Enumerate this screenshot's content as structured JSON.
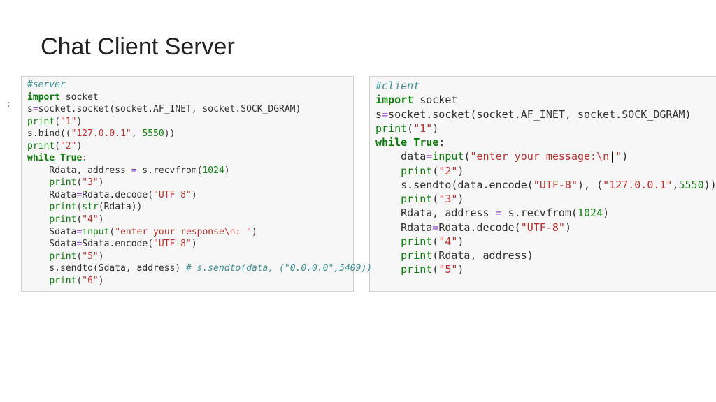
{
  "title": "Chat Client Server",
  "in_prompt": ":",
  "server": {
    "l1": "#server",
    "l2a": "import",
    "l2b": " socket",
    "l3a": "s",
    "l3b": "=",
    "l3c": "socket.socket(socket.AF_INET, socket.SOCK_DGRAM)",
    "l4a": "print",
    "l4b": "(",
    "l4c": "\"1\"",
    "l4d": ")",
    "l5a": "s.bind((",
    "l5b": "\"127.0.0.1\"",
    "l5c": ", ",
    "l5d": "5550",
    "l5e": "))",
    "l6a": "print",
    "l6b": "(",
    "l6c": "\"2\"",
    "l6d": ")",
    "l7a": "while",
    "l7b": " ",
    "l7c": "True",
    "l7d": ":",
    "l8a": "    Rdata, address ",
    "l8b": "=",
    "l8c": " s.recvfrom(",
    "l8d": "1024",
    "l8e": ")",
    "l9a": "    ",
    "l9b": "print",
    "l9c": "(",
    "l9d": "\"3\"",
    "l9e": ")",
    "l10a": "    Rdata",
    "l10b": "=",
    "l10c": "Rdata.decode(",
    "l10d": "\"UTF-8\"",
    "l10e": ")",
    "l11a": "    ",
    "l11b": "print",
    "l11c": "(",
    "l11d": "str",
    "l11e": "(Rdata))",
    "l12a": "    ",
    "l12b": "print",
    "l12c": "(",
    "l12d": "\"4\"",
    "l12e": ")",
    "l13a": "    Sdata",
    "l13b": "=",
    "l13c": "input",
    "l13d": "(",
    "l13e": "\"enter your response\\n: \"",
    "l13f": ")",
    "l14a": "    Sdata",
    "l14b": "=",
    "l14c": "Sdata.encode(",
    "l14d": "\"UTF-8\"",
    "l14e": ")",
    "l15a": "    ",
    "l15b": "print",
    "l15c": "(",
    "l15d": "\"5\"",
    "l15e": ")",
    "l16a": "    s.sendto(Sdata, address) ",
    "l16b": "# s.sendto(data, (\"0.0.0.0\",5409))",
    "l17a": "    ",
    "l17b": "print",
    "l17c": "(",
    "l17d": "\"6\"",
    "l17e": ")"
  },
  "client": {
    "l1": "#client",
    "l2a": "import",
    "l2b": " socket",
    "l3a": "s",
    "l3b": "=",
    "l3c": "socket.socket(socket.AF_INET, socket.SOCK_DGRAM)",
    "l4a": "print",
    "l4b": "(",
    "l4c": "\"1\"",
    "l4d": ")",
    "l5a": "while",
    "l5b": " ",
    "l5c": "True",
    "l5d": ":",
    "l6a": "    data",
    "l6b": "=",
    "l6c": "input",
    "l6d": "(",
    "l6e": "\"enter your message:\\n",
    "l6f": "|",
    "l6g": "\"",
    "l6h": ")",
    "l7a": "    ",
    "l7b": "print",
    "l7c": "(",
    "l7d": "\"2\"",
    "l7e": ")",
    "l8a": "    s.sendto(data.encode(",
    "l8b": "\"UTF-8\"",
    "l8c": "), (",
    "l8d": "\"127.0.0.1\"",
    "l8e": ",",
    "l8f": "5550",
    "l8g": "))",
    "l9a": "    ",
    "l9b": "print",
    "l9c": "(",
    "l9d": "\"3\"",
    "l9e": ")",
    "l10a": "    Rdata, address ",
    "l10b": "=",
    "l10c": " s.recvfrom(",
    "l10d": "1024",
    "l10e": ")",
    "l11a": "    Rdata",
    "l11b": "=",
    "l11c": "Rdata.decode(",
    "l11d": "\"UTF-8\"",
    "l11e": ")",
    "l12a": "    ",
    "l12b": "print",
    "l12c": "(",
    "l12d": "\"4\"",
    "l12e": ")",
    "l13a": "    ",
    "l13b": "print",
    "l13c": "(Rdata, address)",
    "l14a": "    ",
    "l14b": "print",
    "l14c": "(",
    "l14d": "\"5\"",
    "l14e": ")"
  }
}
